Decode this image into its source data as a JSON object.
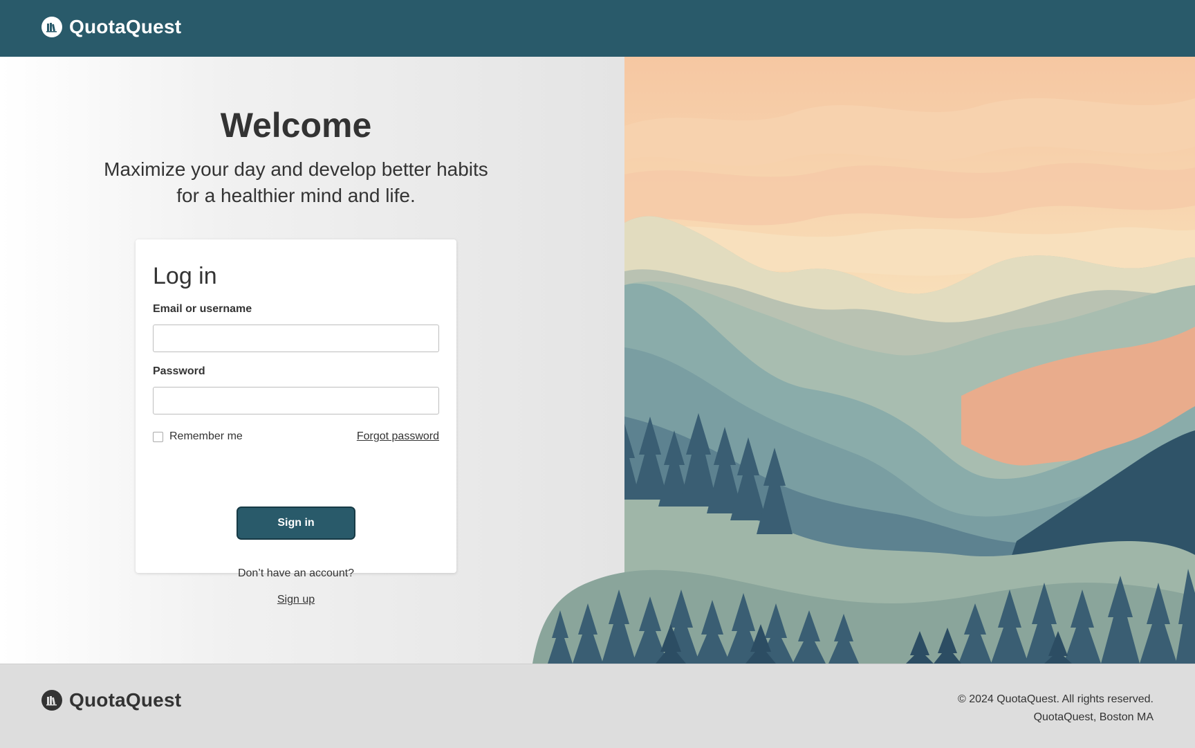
{
  "header": {
    "brand": "QuotaQuest",
    "logo_icon": "books-icon"
  },
  "hero": {
    "title": "Welcome",
    "tagline_line1": "Maximize your day and develop better habits",
    "tagline_line2": "for a healthier mind and life."
  },
  "login": {
    "title": "Log in",
    "email_label": "Email or username",
    "email_value": "",
    "password_label": "Password",
    "password_value": "",
    "remember_label": "Remember me",
    "remember_checked": false,
    "forgot_label": "Forgot password",
    "signin_label": "Sign in",
    "no_account_text": "Don’t have an account?",
    "signup_label": "Sign up"
  },
  "footer": {
    "brand": "QuotaQuest",
    "copyright": "© 2024 QuotaQuest. All rights reserved.",
    "location": "QuotaQuest, Boston MA"
  },
  "colors": {
    "primary": "#295a6a",
    "primary_border": "#173a45",
    "footer_bg": "#dddddd",
    "text": "#333333"
  }
}
